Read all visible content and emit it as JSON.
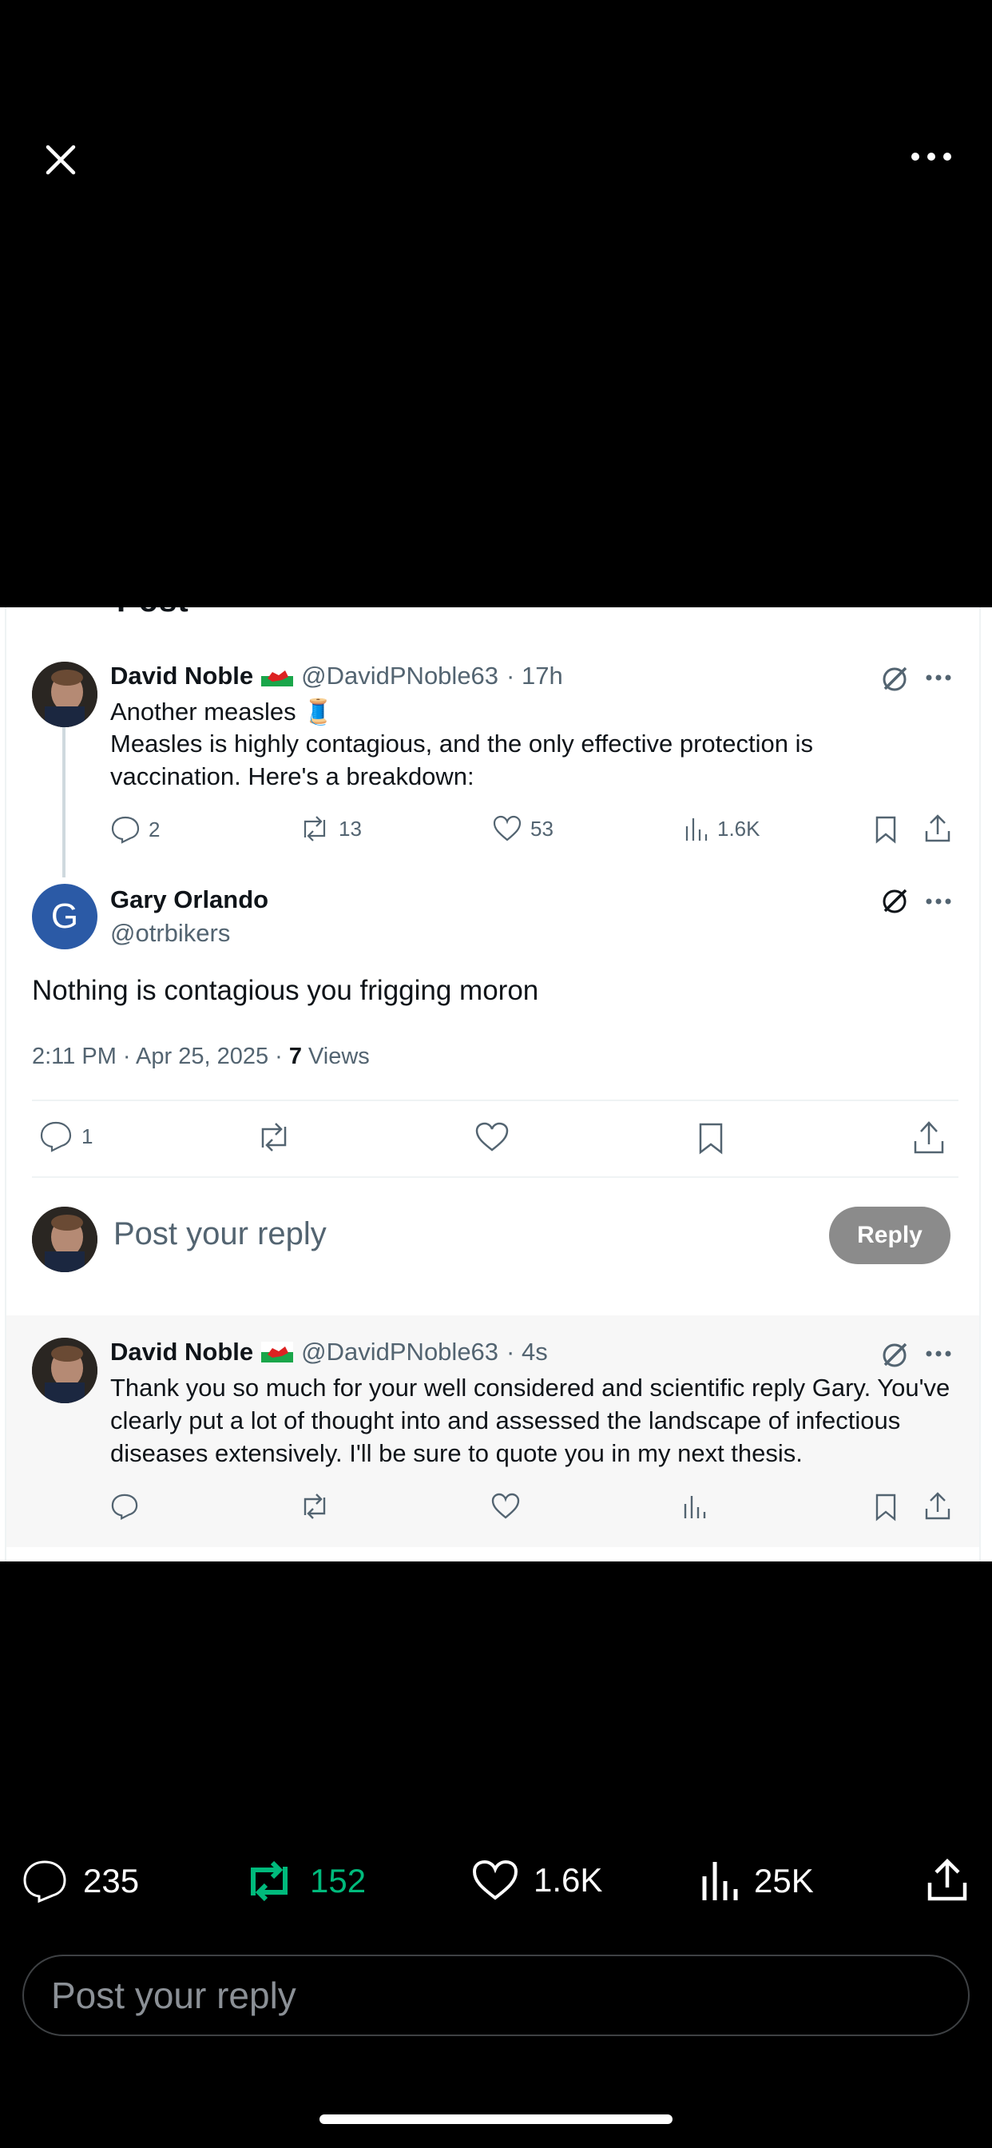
{
  "header": {
    "close_icon": "close-icon",
    "more_icon": "more-icon",
    "cutoff_title": "Post"
  },
  "original_post": {
    "name": "David Noble",
    "flag": "wales-flag",
    "handle": "@DavidPNoble63",
    "time": "· 17h",
    "line1": "Another measles 🧵",
    "body": "Measles is highly contagious, and the only effective protection is vaccination. Here's a breakdown:",
    "replies": "2",
    "reposts": "13",
    "likes": "53",
    "views": "1.6K"
  },
  "focused_post": {
    "avatar_letter": "G",
    "name": "Gary Orlando",
    "handle": "@otrbikers",
    "body": "Nothing is contagious you frigging moron",
    "meta": "2:11 PM · Apr 25, 2025 ·",
    "views_count": "7",
    "views_label": "Views",
    "replies": "1"
  },
  "inline_reply": {
    "placeholder": "Post your reply",
    "button": "Reply"
  },
  "new_reply": {
    "name": "David Noble",
    "handle": "@DavidPNoble63",
    "time": "· 4s",
    "body": "Thank you so much for your well considered and scientific reply Gary. You've clearly put a lot of thought into and assessed the landscape of infectious diseases extensively. I'll be sure to quote you in my next thesis."
  },
  "bottom_bar": {
    "replies": "235",
    "reposts": "152",
    "likes": "1.6K",
    "views": "25K",
    "repost_color": "#00ba7c"
  },
  "composer": {
    "placeholder": "Post your reply"
  }
}
